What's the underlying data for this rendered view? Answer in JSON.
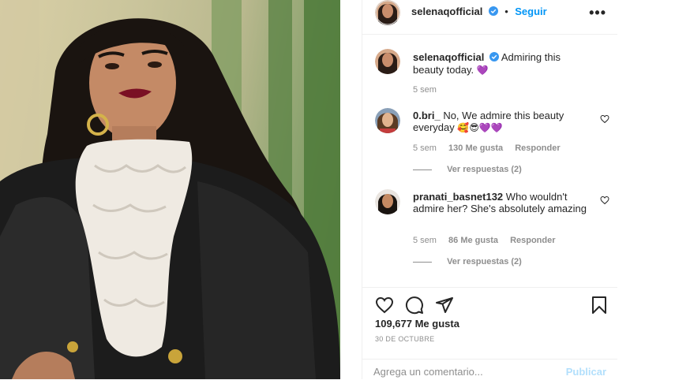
{
  "post": {
    "author": "selenaqofficial",
    "follow_label": "Seguir",
    "dot": "•",
    "more_label": "•••",
    "caption": "Admiring this beauty today.",
    "caption_emoji": "💜",
    "caption_time": "5 sem",
    "likes": "109,677 Me gusta",
    "date": "30 DE OCTUBRE",
    "comment_placeholder": "Agrega un comentario...",
    "publish_label": "Publicar"
  },
  "comments": [
    {
      "user": "0.bri_",
      "text": "No, We admire this beauty everyday",
      "emoji": "🥰😎💜💜",
      "time": "5 sem",
      "likes": "130 Me gusta",
      "reply": "Responder",
      "view_replies": "Ver respuestas (2)"
    },
    {
      "user": "pranati_basnet132",
      "text": "Who wouldn't admire her? She's absolutely amazing",
      "time": "5 sem",
      "likes": "86 Me gusta",
      "reply": "Responder",
      "view_replies": "Ver respuestas (2)"
    }
  ],
  "icons": {
    "verified": "verified-badge-icon",
    "like": "heart-icon",
    "comment": "comment-icon",
    "share": "paper-plane-icon",
    "save": "bookmark-icon",
    "comment_like": "heart-outline-icon"
  },
  "colors": {
    "accent": "#0095f6",
    "muted": "#8e8e8e",
    "publish_disabled": "#b2dffc",
    "border": "#efefef"
  }
}
